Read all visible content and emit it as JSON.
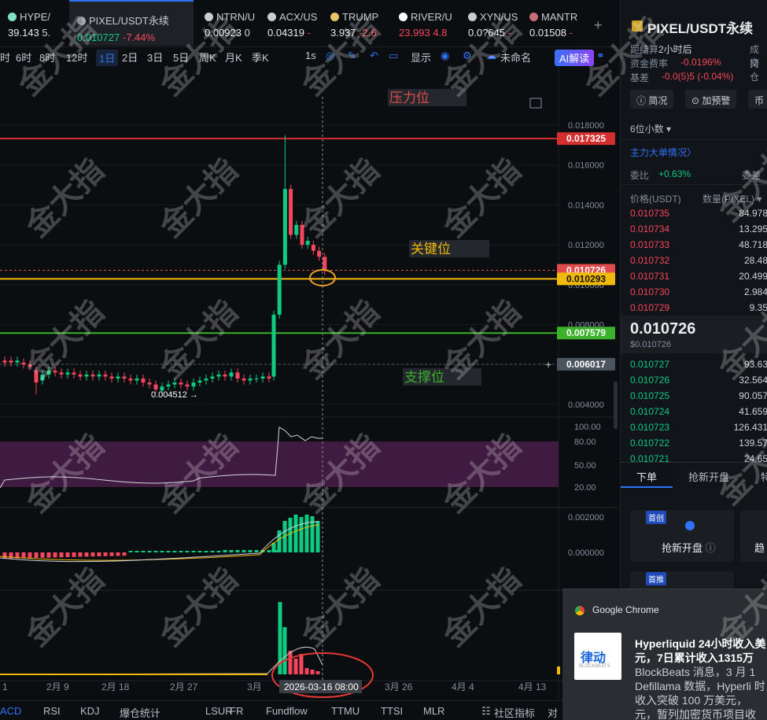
{
  "tickers": [
    {
      "symbol": "HYPE/",
      "price": "39.143",
      "change": "5.",
      "dir": "up",
      "icon_color": "#7de3c4"
    },
    {
      "symbol": "PIXEL/USDT永续",
      "price": "0.010727",
      "change": "-7.44%",
      "dir": "down",
      "icon_color": "#8a8f99",
      "active": true
    },
    {
      "symbol": "NTRN/U",
      "price": "0.00923",
      "change": "0",
      "dir": "flat",
      "icon_color": "#ccc"
    },
    {
      "symbol": "ACX/US",
      "price": "0.04319",
      "change": "-",
      "dir": "down",
      "icon_color": "#ccc"
    },
    {
      "symbol": "TRUMP",
      "price": "3.937",
      "change": "-2.6",
      "dir": "down",
      "icon_color": "#e9c46a"
    },
    {
      "symbol": "RIVER/U",
      "price": "23.993",
      "change": "4.8",
      "dir": "up-red",
      "icon_color": "#fff"
    },
    {
      "symbol": "XYN/US",
      "price": "0.0?645",
      "change": "-",
      "dir": "down",
      "icon_color": "#ccc"
    },
    {
      "symbol": "MANTR",
      "price": "0.01508",
      "change": "-",
      "dir": "down",
      "icon_color": "#c86d7a"
    }
  ],
  "toolbar": {
    "timeframes": [
      "时",
      "6时",
      "8时",
      "12时",
      "1日",
      "2日",
      "3日",
      "5日",
      "周K",
      "月K",
      "季K"
    ],
    "active_timeframe": "1日",
    "right_items": [
      "1s",
      "显示",
      "未命名",
      "AI解读"
    ]
  },
  "chart": {
    "price_labels": [
      "0.018000",
      "0.016000",
      "0.014000",
      "0.012000",
      "0.010000",
      "0.008000",
      "0.006000",
      "0.004000"
    ],
    "markers": [
      {
        "label": "0.017325",
        "color": "#d32f2f",
        "line": "#d32f2f"
      },
      {
        "label": "0.010726",
        "color": "#e04b4b",
        "line": "dashed"
      },
      {
        "label": "0.010293",
        "color": "#f0b90b",
        "line": "#f0b90b"
      },
      {
        "label": "0.007579",
        "color": "#3cb22c",
        "line": "#3cb22c"
      },
      {
        "label": "0.006017",
        "color": "#4a5560",
        "line": "dashed"
      }
    ],
    "annotations": [
      "压力位",
      "关键位",
      "支撑位"
    ],
    "low_marker": "0.004512 →",
    "rsi_labels": [
      "100.00",
      "80.00",
      "50.00",
      "20.00"
    ],
    "macd_labels": [
      "0.002000",
      "0.000000"
    ],
    "date_labels": [
      "2月 9",
      "2月 18",
      "2月 27",
      "3月",
      "3月 26",
      "4月 4",
      "4月 13"
    ],
    "crosshair_date": "2026-03-16 08:00",
    "left_date_stub": "1"
  },
  "indicators": [
    "ACD",
    "RSI",
    "KDJ",
    "爆仓统计",
    "LSUR",
    "FR",
    "Fundflow",
    "TTMU",
    "TTSI",
    "MLR",
    "社区指标",
    "对"
  ],
  "right_panel": {
    "title": "PIXEL/USDT永续",
    "settlement_label": "距结算",
    "settlement_value": "2小时后",
    "settlement_right": "成交",
    "funding_label": "资金费率",
    "funding_value": "-0.0196%",
    "funding_right": "持仓",
    "basis_label": "基差",
    "basis_value": "-0.0(5)5 (-0.04%)",
    "buttons": [
      "简况",
      "加预警",
      "币"
    ],
    "precision": "6位小数",
    "big_orders": "主力大单情况",
    "ratio_label": "委比",
    "ratio_value": "+0.63%",
    "ratio_right": "委差",
    "col_price": "价格(USDT)",
    "col_qty": "数量(PIXEL)",
    "asks": [
      [
        "0.010735",
        "84.978"
      ],
      [
        "0.010734",
        "13.295"
      ],
      [
        "0.010733",
        "48.718"
      ],
      [
        "0.010732",
        "28.48"
      ],
      [
        "0.010731",
        "20.499"
      ],
      [
        "0.010730",
        "2.984"
      ],
      [
        "0.010729",
        "9.35"
      ]
    ],
    "last_price": "0.010726",
    "last_sub": "$0.010726",
    "bids": [
      [
        "0.010727",
        "93.63"
      ],
      [
        "0.010726",
        "32.564"
      ],
      [
        "0.010725",
        "90.057"
      ],
      [
        "0.010724",
        "41.659"
      ],
      [
        "0.010723",
        "126.431"
      ],
      [
        "0.010722",
        "139.57"
      ],
      [
        "0.010721",
        "24.65"
      ]
    ],
    "tabs": [
      "下单",
      "抢新开盘",
      "特"
    ],
    "card1_badge": "首创",
    "card1_label": "抢新开盘",
    "card1_right": "趋",
    "card2_badge": "首推"
  },
  "notification": {
    "app": "Google Chrome",
    "logo_text": "律动",
    "logo_sub": "BLOCKBEATS",
    "title": "Hyperliquid 24小时收入美元，7日累计收入1315万",
    "body": "BlockBeats 消息，3 月 1 Defillama 数据，Hyperli 时收入突破 100 万美元，元，暂列加密货币项目收"
  },
  "watermark": "金大指",
  "colors": {
    "up": "#0ecb81",
    "down": "#f6465d",
    "accent": "#2f74f6",
    "bg": "#0b0e11"
  }
}
